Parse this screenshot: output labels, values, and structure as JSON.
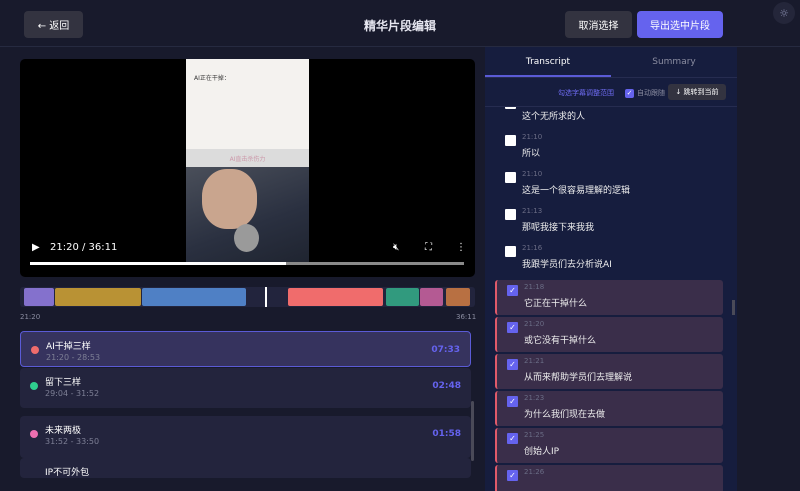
{
  "header": {
    "back_label": "← 返回",
    "title": "精华片段编辑",
    "cancel_label": "取消选择",
    "export_label": "导出选中片段",
    "settings_icon": "☼"
  },
  "video": {
    "current_time": "21:20",
    "duration": "36:11",
    "time_display": "21:20 / 36:11",
    "progress": 0.59,
    "frame_caption": "AI正在干掉：",
    "frame_band": "AI直击杀伤力"
  },
  "timeline": {
    "start_label": "21:20",
    "end_label": "36:11",
    "playhead": 0.54,
    "segments": [
      {
        "color": "#8471cd",
        "start": 0.0,
        "end": 0.07
      },
      {
        "color": "#b99234",
        "start": 0.07,
        "end": 0.265
      },
      {
        "color": "#4f80c5",
        "start": 0.265,
        "end": 0.5
      },
      {
        "color": "#f06c6c",
        "start": 0.59,
        "end": 0.805
      },
      {
        "color": "#319a7e",
        "start": 0.81,
        "end": 0.885
      },
      {
        "color": "#b45a93",
        "start": 0.885,
        "end": 0.94
      },
      {
        "color": "#b87042",
        "start": 0.945,
        "end": 1.0
      }
    ]
  },
  "segments": [
    {
      "name": "AI干掉三样",
      "range": "21:20 - 28:53",
      "duration": "07:33",
      "color": "#f06c6c",
      "active": true
    },
    {
      "name": "留下三样",
      "range": "29:04 - 31:52",
      "duration": "02:48",
      "color": "#2fcf8f"
    },
    {
      "name": "未来两极",
      "range": "31:52 - 33:50",
      "duration": "01:58",
      "color": "#ec6fb0"
    },
    {
      "name": "IP不可外包",
      "range": "",
      "duration": ""
    }
  ],
  "transcript_panel": {
    "tabs": [
      "Transcript",
      "Summary"
    ],
    "adjust_label": "勾选字幕调整范围",
    "auto_follow_label": "自动跟随",
    "jump_label": "↓ 跳转到当前",
    "items": [
      {
        "time": "",
        "text": "这个无所求的人",
        "checked": false
      },
      {
        "time": "21:10",
        "text": "所以",
        "checked": false
      },
      {
        "time": "21:10",
        "text": "这是一个很容易理解的逻辑",
        "checked": false
      },
      {
        "time": "21:13",
        "text": "那呢我接下来我我",
        "checked": false
      },
      {
        "time": "21:16",
        "text": "我跟学员们去分析说AI",
        "checked": false
      },
      {
        "time": "21:18",
        "text": "它正在干掉什么",
        "checked": true
      },
      {
        "time": "21:20",
        "text": "或它没有干掉什么",
        "checked": true
      },
      {
        "time": "21:21",
        "text": "从而来帮助学员们去理解说",
        "checked": true
      },
      {
        "time": "21:23",
        "text": "为什么我们现在去做",
        "checked": true
      },
      {
        "time": "21:25",
        "text": "创始人IP",
        "checked": true
      },
      {
        "time": "21:26",
        "text": "",
        "checked": true
      }
    ]
  }
}
